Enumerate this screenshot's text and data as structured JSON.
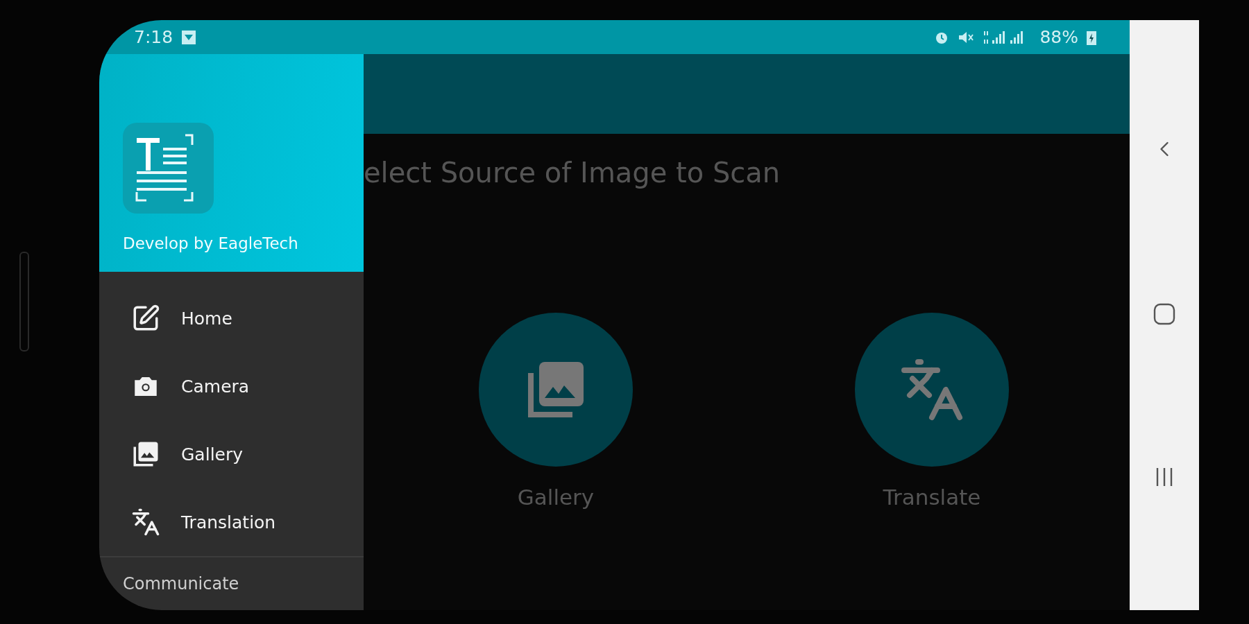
{
  "status_bar": {
    "time": "7:18",
    "battery": "88%"
  },
  "drawer": {
    "header": {
      "subtitle": "Develop by EagleTech"
    },
    "items": [
      {
        "label": "Home",
        "kind": "edit"
      },
      {
        "label": "Camera",
        "kind": "camera"
      },
      {
        "label": "Gallery",
        "kind": "gallery"
      },
      {
        "label": "Translation",
        "kind": "translate"
      }
    ],
    "section": "Communicate"
  },
  "main": {
    "title": "elect Source of Image to Scan",
    "actions": [
      {
        "label": "Gallery",
        "kind": "gallery"
      },
      {
        "label": "Translate",
        "kind": "translate"
      }
    ]
  }
}
